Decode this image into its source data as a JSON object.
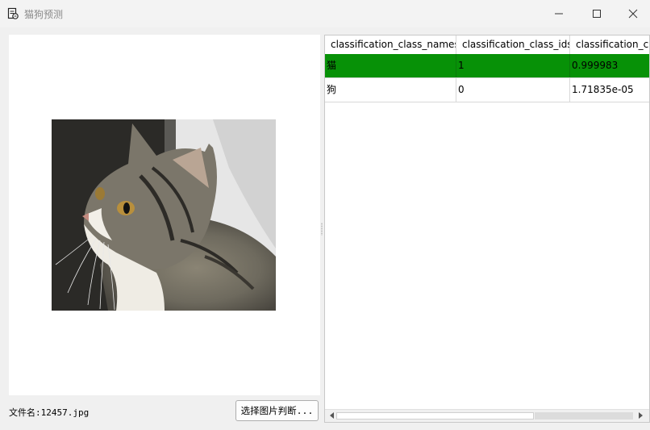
{
  "window": {
    "title": "猫狗预测",
    "icons": {
      "app": "document-edit-icon",
      "minimize": "minimize-icon",
      "maximize": "maximize-icon",
      "close": "close-icon"
    }
  },
  "left_panel": {
    "image_alt": "cat-photo",
    "filename_label": "文件名:12457.jpg",
    "select_button": "选择图片判断..."
  },
  "table": {
    "headers": [
      "classification_class_names",
      "classification_class_ids",
      "classification_c"
    ],
    "rows": [
      {
        "name": "猫",
        "id": "1",
        "score": "0.999983",
        "selected": true
      },
      {
        "name": "狗",
        "id": "0",
        "score": "1.71835e-05",
        "selected": false
      }
    ],
    "selection_color": "#079107"
  }
}
